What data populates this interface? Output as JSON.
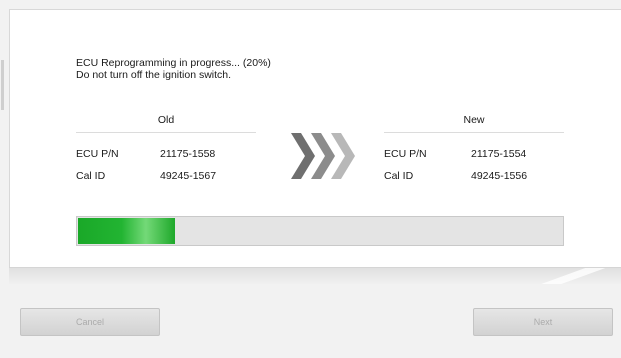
{
  "status": {
    "line1": "ECU Reprogramming in progress... (20%)",
    "line2": "Do not turn off the ignition switch."
  },
  "progress": {
    "fraction": 0.2,
    "fill_color": "#22b432"
  },
  "old_column": {
    "header": "Old",
    "rows": [
      {
        "label": "ECU P/N",
        "value": "21175-1558"
      },
      {
        "label": "Cal ID",
        "value": "49245-1567"
      }
    ]
  },
  "new_column": {
    "header": "New",
    "rows": [
      {
        "label": "ECU P/N",
        "value": "21175-1554"
      },
      {
        "label": "Cal ID",
        "value": "49245-1556"
      }
    ]
  },
  "transfer_icon": "triple-chevron-right-icon",
  "buttons": {
    "cancel_label": "Cancel",
    "next_label": "Next"
  },
  "colors": {
    "progress_green": "#22b432",
    "panel_bg": "#ffffff",
    "disabled_text": "#ababab"
  }
}
